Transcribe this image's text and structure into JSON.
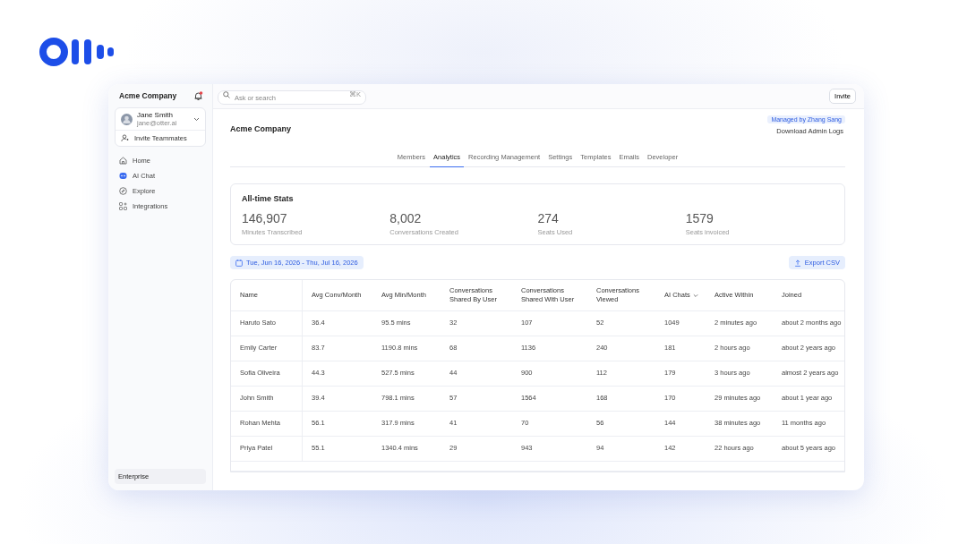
{
  "sidebar": {
    "workspace": "Acme Company",
    "notification": true,
    "user": {
      "name": "Jane Smith",
      "email": "jane@otter.ai"
    },
    "invite": "Invite Teammates",
    "items": [
      {
        "label": "Home",
        "kind": "home"
      },
      {
        "label": "AI Chat",
        "kind": "chat"
      },
      {
        "label": "Explore",
        "kind": "explore"
      },
      {
        "label": "Integrations",
        "kind": "integrations"
      }
    ],
    "plan": "Enterprise"
  },
  "topbar": {
    "search": {
      "placeholder": "Ask or search",
      "shortcut": "⌘K"
    },
    "invite_button": "Invite"
  },
  "page": {
    "title": "Acme Company",
    "managed_badge": "Managed by Zhang Sang",
    "download_link": "Download Admin Logs"
  },
  "tabs": [
    {
      "label": "Members",
      "selected": false
    },
    {
      "label": "Analytics",
      "selected": true
    },
    {
      "label": "Recording Management",
      "selected": false
    },
    {
      "label": "Settings",
      "selected": false
    },
    {
      "label": "Templates",
      "selected": false
    },
    {
      "label": "Emails",
      "selected": false
    },
    {
      "label": "Developer",
      "selected": false
    }
  ],
  "stats": {
    "title": "All-time Stats",
    "items": [
      {
        "value": "146,907",
        "label": "Minutes Transcribed"
      },
      {
        "value": "8,002",
        "label": "Conversations Created"
      },
      {
        "value": "274",
        "label": "Seats Used"
      },
      {
        "value": "1579",
        "label": "Seats invoiced"
      }
    ]
  },
  "date_range": "Tue, Jun 16, 2026 - Thu, Jul 16, 2026",
  "export_button": "Export CSV",
  "table": {
    "columns": [
      {
        "label": "Name",
        "sorted": false
      },
      {
        "label": "Avg Conv/Month",
        "sorted": false
      },
      {
        "label": "Avg Min/Month",
        "sorted": false
      },
      {
        "label": "Conversations Shared By User",
        "sorted": false
      },
      {
        "label": "Conversations Shared With User",
        "sorted": false
      },
      {
        "label": "Conversations Viewed",
        "sorted": false
      },
      {
        "label": "AI Chats",
        "sorted": true
      },
      {
        "label": "Active Within",
        "sorted": false
      },
      {
        "label": "Joined",
        "sorted": false
      }
    ],
    "rows": [
      [
        "Haruto Sato",
        "36.4",
        "95.5 mins",
        "32",
        "107",
        "52",
        "1049",
        "2 minutes ago",
        "about 2 months ago"
      ],
      [
        "Emily Carter",
        "83.7",
        "1190.8 mins",
        "68",
        "1136",
        "240",
        "181",
        "2 hours ago",
        "about 2 years ago"
      ],
      [
        "Sofia Oliveira",
        "44.3",
        "527.5 mins",
        "44",
        "900",
        "112",
        "179",
        "3 hours ago",
        "almost 2 years ago"
      ],
      [
        "John Smith",
        "39.4",
        "798.1 mins",
        "57",
        "1564",
        "168",
        "170",
        "29 minutes ago",
        "about 1 year ago"
      ],
      [
        "Rohan Mehta",
        "56.1",
        "317.9 mins",
        "41",
        "70",
        "56",
        "144",
        "38 minutes ago",
        "11 months ago"
      ],
      [
        "Priya Patel",
        "55.1",
        "1340.4 mins",
        "29",
        "943",
        "94",
        "142",
        "22 hours ago",
        "about 5 years ago"
      ]
    ]
  }
}
